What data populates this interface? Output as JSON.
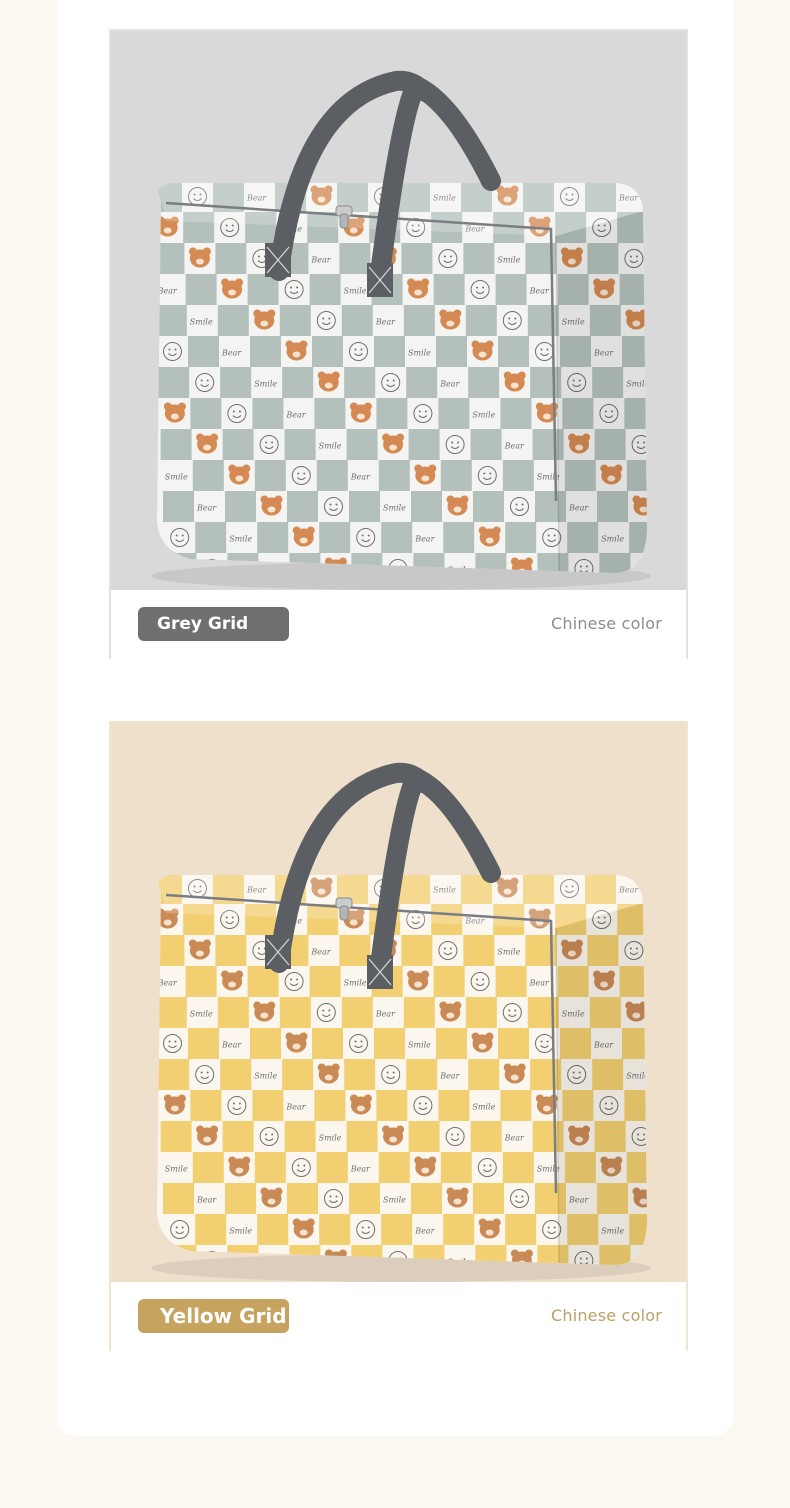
{
  "products": [
    {
      "variant_label": "Grey Grid",
      "color_note": "Chinese color",
      "pattern_texts": [
        "Bear",
        "Smile"
      ],
      "colors": {
        "background": "#d9d9d9",
        "check": "#a8b6b3",
        "check_light": "#f4f5f2",
        "bear": "#d48a52",
        "handle": "#5b5e63",
        "label_pill": "#6f6f6f",
        "note_text": "#8d8d8d"
      }
    },
    {
      "variant_label": "Yellow Grid",
      "color_note": "Chinese color",
      "pattern_texts": [
        "Bear",
        "Smile"
      ],
      "colors": {
        "background": "#efe0cc",
        "check": "#f0c85a",
        "check_light": "#fbf7ee",
        "bear": "#c98a55",
        "handle": "#5b5e63",
        "label_pill": "#c6a35f",
        "note_text": "#bc9f67"
      }
    }
  ]
}
